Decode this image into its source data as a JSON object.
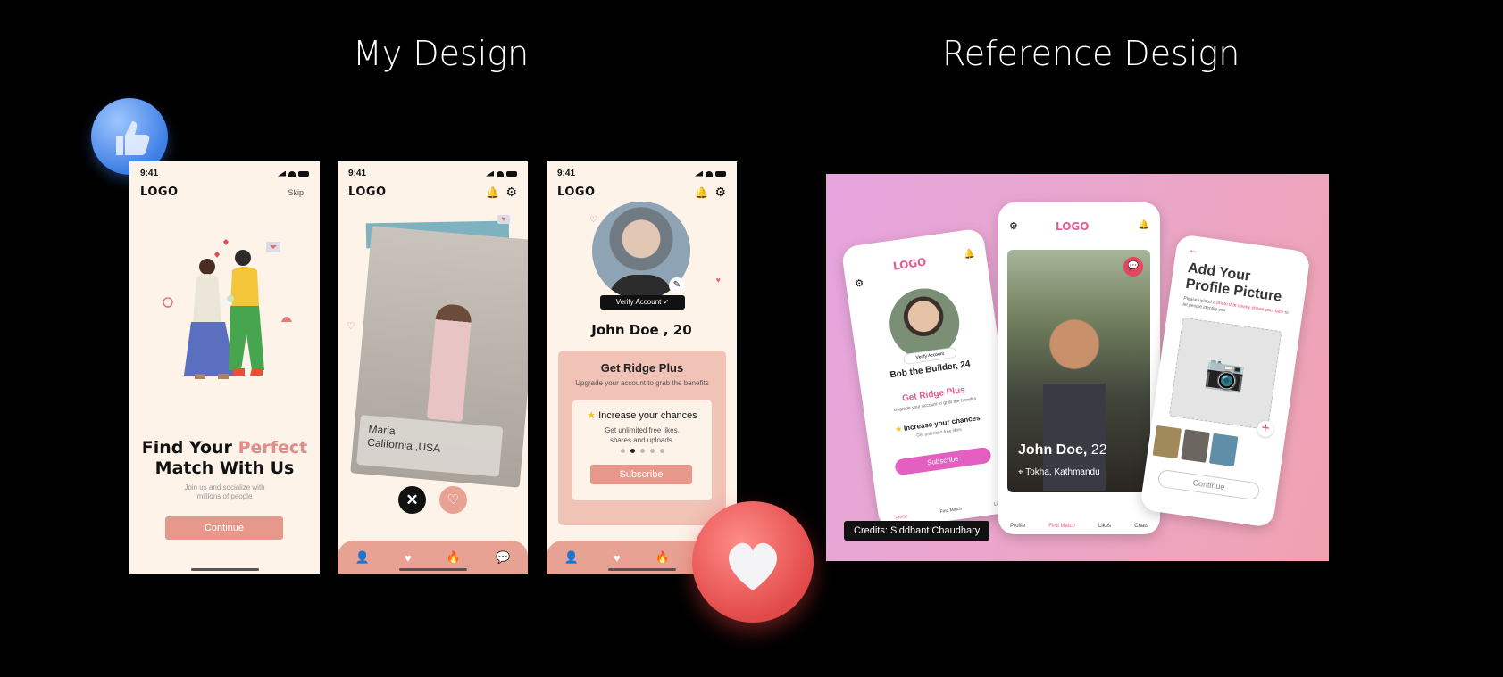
{
  "headings": {
    "left": "My Design",
    "right": "Reference Design"
  },
  "colors": {
    "accent": "#e8988a",
    "accent_text": "#e58b8b",
    "cream": "#fdf3e9",
    "ref_pink": "#e35f93"
  },
  "phone1": {
    "time": "9:41",
    "logo": "LOGO",
    "skip": "Skip",
    "title_a": "Find Your",
    "title_b": "Perfect",
    "title_c": "Match With Us",
    "subtitle": "Join us and socialize with millions of people",
    "continue": "Continue"
  },
  "phone2": {
    "time": "9:41",
    "logo": "LOGO",
    "card_name": "Maria",
    "card_loc": "California ,USA",
    "nav_icons": [
      "person-icon",
      "heart-icon",
      "flame-icon",
      "chat-icon"
    ]
  },
  "phone3": {
    "time": "9:41",
    "logo": "LOGO",
    "verify": "Verify Account",
    "name": "John Doe , 20",
    "plus_title": "Get Ridge Plus",
    "plus_sub": "Upgrade your account to grab the benefits",
    "feature_title": "Increase your chances",
    "feature_desc": "Get unlimited free likes, shares and uploads.",
    "subscribe": "Subscribe"
  },
  "reference": {
    "left": {
      "logo": "LOGO",
      "verify": "Verify Account",
      "name": "Bob the Builder, 24",
      "plus_title": "Get Ridge Plus",
      "plus_sub": "Upgrade your account to grab the benefits",
      "feature_title": "Increase your chances",
      "feature_desc": "Get unlimited free likes",
      "subscribe": "Subscribe",
      "nav": [
        "Profile",
        "Find Match",
        "Likes"
      ]
    },
    "middle": {
      "logo": "LOGO",
      "name": "John Doe,",
      "age": "22",
      "location": "Tokha, Kathmandu",
      "nav": [
        "Profile",
        "Find Match",
        "Likes",
        "Chats"
      ]
    },
    "right": {
      "title": "Add Your Profile Picture",
      "desc_a": "Please upload a ",
      "desc_b": "photo that clearly shows your face",
      "desc_c": " to let people identify you",
      "continue": "Continue"
    },
    "credits": "Credits: Siddhant Chaudhary"
  }
}
